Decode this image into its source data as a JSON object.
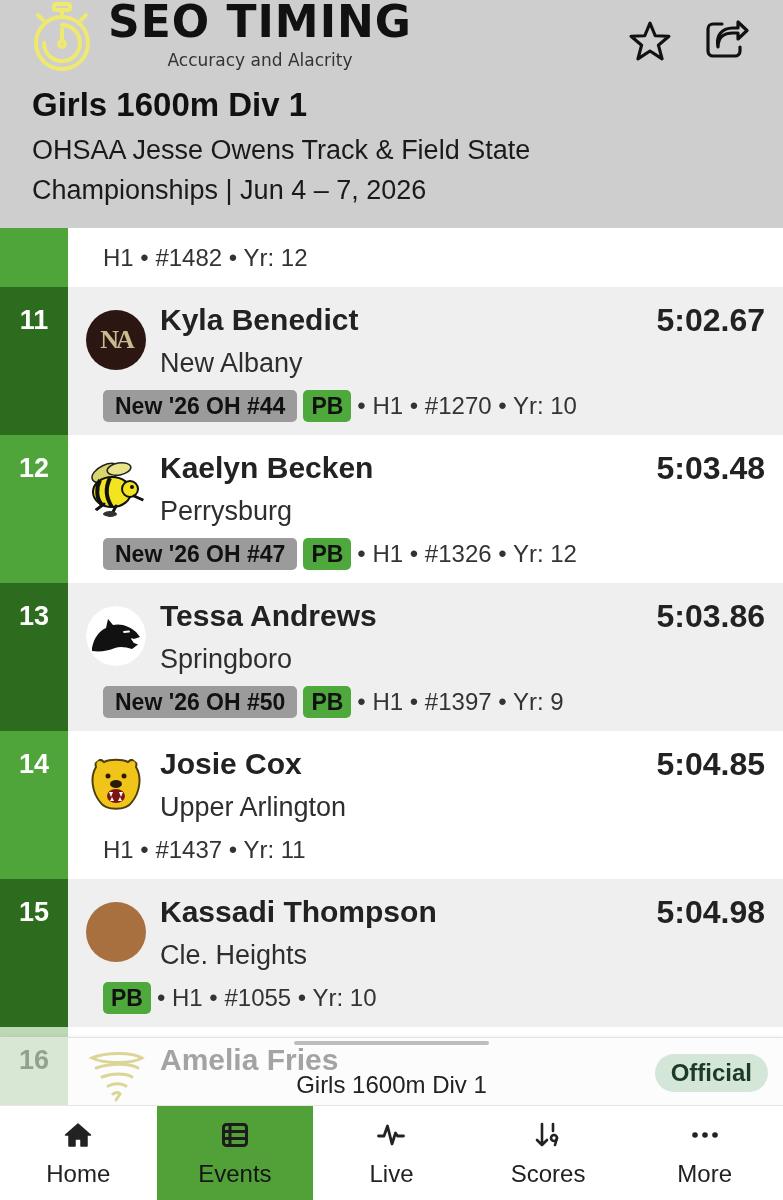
{
  "header": {
    "brand": {
      "name": "SEO TIMING",
      "tagline": "Accuracy and Alacrity"
    },
    "title": "Girls 1600m Div 1",
    "subtitle": "OHSAA Jesse Owens Track & Field State Championships | Jun 4 – 7, 2026"
  },
  "results": [
    {
      "details": "H1 • #1482 • Yr: 12"
    },
    {
      "rank": "11",
      "logo_text": "NA",
      "name": "Kyla Benedict",
      "school": "New Albany",
      "time": "5:02.67",
      "badges": [
        {
          "kind": "record",
          "label": "New '26 OH #44"
        },
        {
          "kind": "pb",
          "label": "PB"
        }
      ],
      "details": "• H1 • #1270 • Yr: 10"
    },
    {
      "rank": "12",
      "name": "Kaelyn Becken",
      "school": "Perrysburg",
      "time": "5:03.48",
      "badges": [
        {
          "kind": "record",
          "label": "New '26 OH #47"
        },
        {
          "kind": "pb",
          "label": "PB"
        }
      ],
      "details": "• H1 • #1326 • Yr: 12"
    },
    {
      "rank": "13",
      "name": "Tessa Andrews",
      "school": "Springboro",
      "time": "5:03.86",
      "badges": [
        {
          "kind": "record",
          "label": "New '26 OH #50"
        },
        {
          "kind": "pb",
          "label": "PB"
        }
      ],
      "details": "• H1 • #1397 • Yr: 9"
    },
    {
      "rank": "14",
      "name": "Josie Cox",
      "school": "Upper Arlington",
      "time": "5:04.85",
      "details": "H1 • #1437 • Yr: 11"
    },
    {
      "rank": "15",
      "name": "Kassadi Thompson",
      "school": "Cle. Heights",
      "time": "5:04.98",
      "badges": [
        {
          "kind": "pb",
          "label": "PB"
        }
      ],
      "details": "• H1 • #1055 • Yr: 10"
    },
    {
      "rank": "16",
      "name": "Amelia Fries"
    }
  ],
  "sheet": {
    "title": "Girls 1600m Div 1",
    "status": "Official"
  },
  "tabs": [
    {
      "label": "Home",
      "selected": false
    },
    {
      "label": "Events",
      "selected": true
    },
    {
      "label": "Live",
      "selected": false
    },
    {
      "label": "Scores",
      "selected": false
    },
    {
      "label": "More",
      "selected": false
    }
  ]
}
